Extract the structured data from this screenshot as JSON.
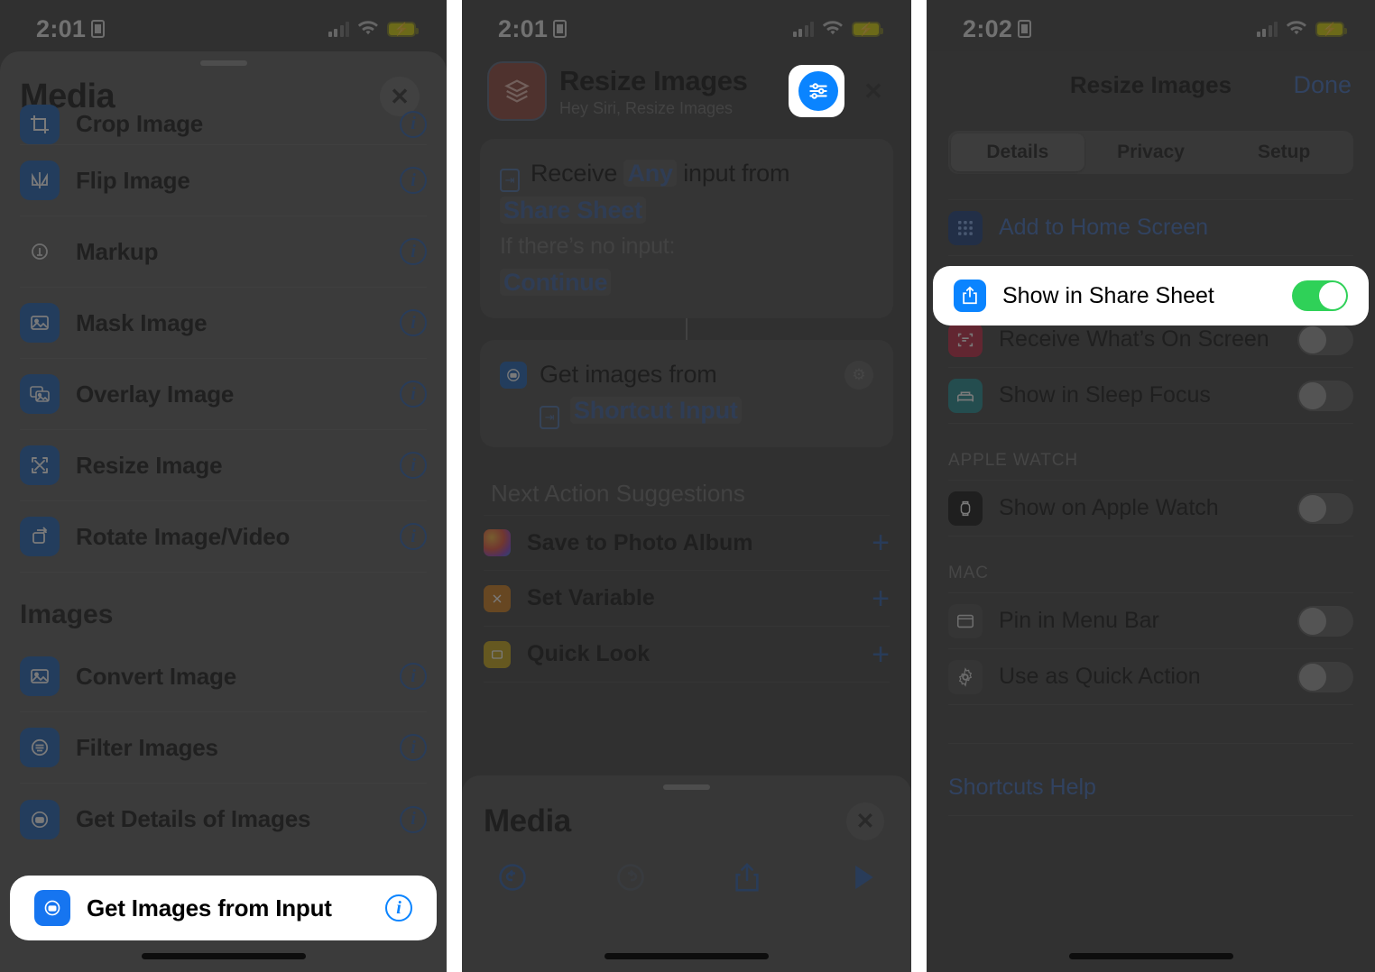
{
  "panels": {
    "panel1": {
      "statusbar": {
        "time": "2:01",
        "battery_state": "charging-low-power"
      },
      "sheet_title": "Media",
      "close_label": "✕",
      "partial_top_item": {
        "label": "Crop Image",
        "icon": "crop-image-icon"
      },
      "items": [
        {
          "label": "Flip Image",
          "icon": "flip-image-icon",
          "icon_color": "#1c5fb4"
        },
        {
          "label": "Markup",
          "icon": "markup-icon",
          "icon_color": "#5a5a5a"
        },
        {
          "label": "Mask Image",
          "icon": "mask-image-icon",
          "icon_color": "#1c5fb4"
        },
        {
          "label": "Overlay Image",
          "icon": "overlay-image-icon",
          "icon_color": "#1c5fb4"
        },
        {
          "label": "Resize Image",
          "icon": "resize-image-icon",
          "icon_color": "#1c5fb4"
        },
        {
          "label": "Rotate Image/Video",
          "icon": "rotate-image-video-icon",
          "icon_color": "#1c5fb4"
        }
      ],
      "section_images": "Images",
      "images_items": [
        {
          "label": "Convert Image",
          "icon": "convert-image-icon",
          "icon_color": "#1c5fb4"
        },
        {
          "label": "Filter Images",
          "icon": "filter-images-icon",
          "icon_color": "#1c5fb4"
        },
        {
          "label": "Get Details of Images",
          "icon": "get-details-of-images-icon",
          "icon_color": "#1c5fb4"
        }
      ],
      "highlighted_item": {
        "label": "Get Images from Input",
        "icon": "get-images-from-input-icon",
        "icon_color": "#1675f0"
      },
      "info_glyph": "i"
    },
    "panel2": {
      "statusbar": {
        "time": "2:01",
        "battery_state": "charging-low-power"
      },
      "shortcut_name": "Resize Images",
      "shortcut_subtitle": "Hey Siri, Resize Images",
      "settings_button": "settings-sliders-icon",
      "close_label": "✕",
      "action1": {
        "receive_text": "Receive",
        "any_token": "Any",
        "input_from_text": "input from",
        "share_sheet_token": "Share Sheet",
        "no_input_label": "If there’s no input:",
        "continue_token": "Continue"
      },
      "action2": {
        "title": "Get images from",
        "input_token": "Shortcut Input"
      },
      "suggestions_header": "Next Action Suggestions",
      "suggestions": [
        {
          "label": "Save to Photo Album",
          "icon": "photos-app-icon",
          "add": "+"
        },
        {
          "label": "Set Variable",
          "icon": "set-variable-icon",
          "add": "+"
        },
        {
          "label": "Quick Look",
          "icon": "quick-look-icon",
          "add": "+"
        }
      ],
      "bottom_sheet_title": "Media",
      "bottom_close_label": "✕",
      "toolbar": [
        "undo-icon",
        "redo-icon",
        "share-icon",
        "play-icon"
      ]
    },
    "panel3": {
      "statusbar": {
        "time": "2:02",
        "battery_state": "charging-low-power"
      },
      "nav_title": "Resize Images",
      "done_label": "Done",
      "tabs": [
        {
          "label": "Details",
          "active": true
        },
        {
          "label": "Privacy",
          "active": false
        },
        {
          "label": "Setup",
          "active": false
        }
      ],
      "rows_main": [
        {
          "label": "Add to Home Screen",
          "icon": "home-screen-icon",
          "icon_color": "#1a3a7a",
          "type": "link"
        }
      ],
      "highlighted_row": {
        "label": "Show in Share Sheet",
        "icon": "share-sheet-icon",
        "icon_color": "#0a84ff",
        "toggle": true
      },
      "rows_after": [
        {
          "label": "Receive What’s On Screen",
          "icon": "receive-on-screen-icon",
          "icon_color": "#c0223f",
          "toggle": false
        },
        {
          "label": "Show in Sleep Focus",
          "icon": "sleep-focus-icon",
          "icon_color": "#1f8a8f",
          "toggle": false
        }
      ],
      "section_apple_watch": "APPLE WATCH",
      "rows_watch": [
        {
          "label": "Show on Apple Watch",
          "icon": "apple-watch-icon",
          "icon_color": "#101010",
          "toggle": false
        }
      ],
      "section_mac": "MAC",
      "rows_mac": [
        {
          "label": "Pin in Menu Bar",
          "icon": "menu-bar-icon",
          "icon_color": "#4a4a4a",
          "toggle": false
        },
        {
          "label": "Use as Quick Action",
          "icon": "quick-action-gear-icon",
          "icon_color": "#4a4a4a",
          "toggle": false
        }
      ],
      "help_link": "Shortcuts Help"
    }
  },
  "colors": {
    "accent_blue": "#0a84ff",
    "link_blue": "#3f6dbb",
    "toggle_on_green": "#2fd158",
    "highlight_white": "#ffffff",
    "dim_overlay": "#282828"
  }
}
